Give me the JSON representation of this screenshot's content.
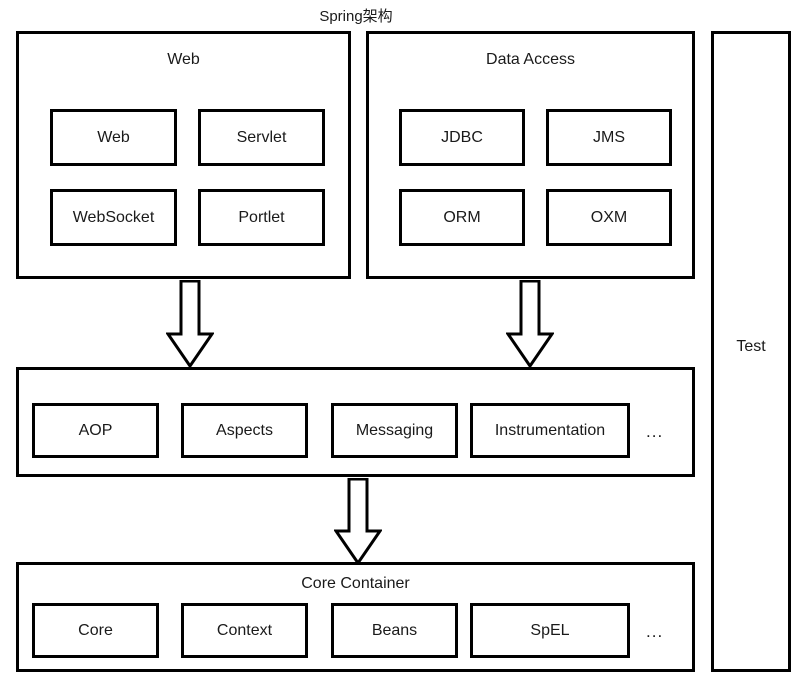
{
  "diagram": {
    "title": "Spring架构",
    "type": "architecture-layer-diagram",
    "stroke_color": "#000000",
    "background_color": "#ffffff",
    "text_color": "#1a1a1a"
  },
  "panels": {
    "web": {
      "title": "Web",
      "cells": [
        {
          "label": "Web"
        },
        {
          "label": "Servlet"
        },
        {
          "label": "WebSocket"
        },
        {
          "label": "Portlet"
        }
      ]
    },
    "data_access": {
      "title": "Data Access",
      "cells": [
        {
          "label": "JDBC"
        },
        {
          "label": "JMS"
        },
        {
          "label": "ORM"
        },
        {
          "label": "OXM"
        }
      ]
    },
    "aop": {
      "title": "",
      "cells": [
        {
          "label": "AOP"
        },
        {
          "label": "Aspects"
        },
        {
          "label": "Messaging"
        },
        {
          "label": "Instrumentation"
        }
      ],
      "more": "..."
    },
    "core_container": {
      "title": "Core Container",
      "cells": [
        {
          "label": "Core"
        },
        {
          "label": "Context"
        },
        {
          "label": "Beans"
        },
        {
          "label": "SpEL"
        }
      ],
      "more": "..."
    },
    "test": {
      "title": "Test"
    }
  },
  "arrows": [
    {
      "name": "web-to-aop",
      "direction": "down"
    },
    {
      "name": "data-access-to-aop",
      "direction": "down"
    },
    {
      "name": "aop-to-core-container",
      "direction": "down"
    }
  ]
}
